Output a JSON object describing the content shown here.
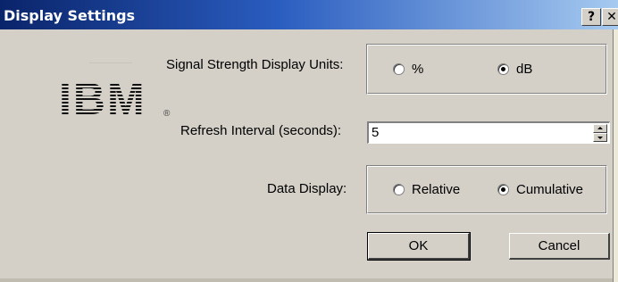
{
  "window": {
    "title": "Display Settings",
    "help_label": "?",
    "close_label": "✕"
  },
  "logo": {
    "text": "IBM",
    "registered": "®"
  },
  "signal_units": {
    "label": "Signal Strength Display Units:",
    "options": [
      {
        "label": "%",
        "checked": false
      },
      {
        "label": "dB",
        "checked": true
      }
    ]
  },
  "refresh": {
    "label": "Refresh Interval (seconds):",
    "value": "5"
  },
  "data_display": {
    "label": "Data Display:",
    "options": [
      {
        "label": "Relative",
        "checked": false
      },
      {
        "label": "Cumulative",
        "checked": true
      }
    ]
  },
  "buttons": {
    "ok": "OK",
    "cancel": "Cancel"
  }
}
